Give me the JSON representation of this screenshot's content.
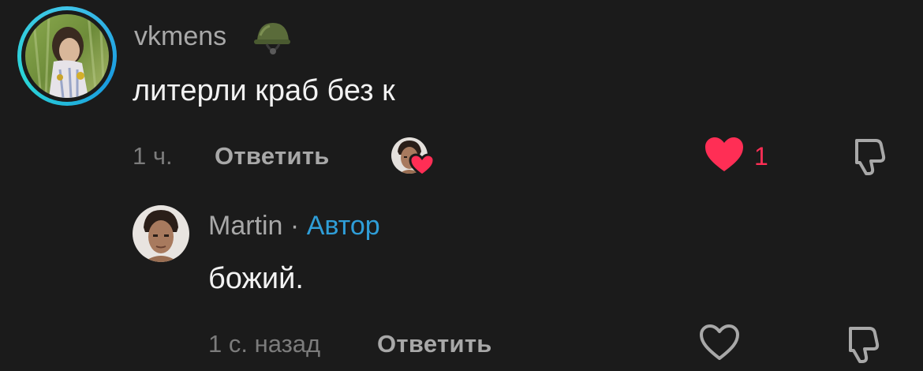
{
  "comments": [
    {
      "username": "vkmens",
      "badge_icon": "helmet-icon",
      "text": "литерли краб без к",
      "time": "1 ч.",
      "reply_label": "Ответить",
      "like_count": "1",
      "liked": true,
      "creator_liked": true
    },
    {
      "username": "Martin",
      "separator": " · ",
      "author_badge": "Автор",
      "text": "божий.",
      "time": "1 с. назад",
      "reply_label": "Ответить",
      "liked": false
    }
  ],
  "colors": {
    "background": "#1b1b1b",
    "like_red": "#ff2e55",
    "author_blue": "#2f9ed8",
    "story_ring": "#3fc3e8"
  }
}
